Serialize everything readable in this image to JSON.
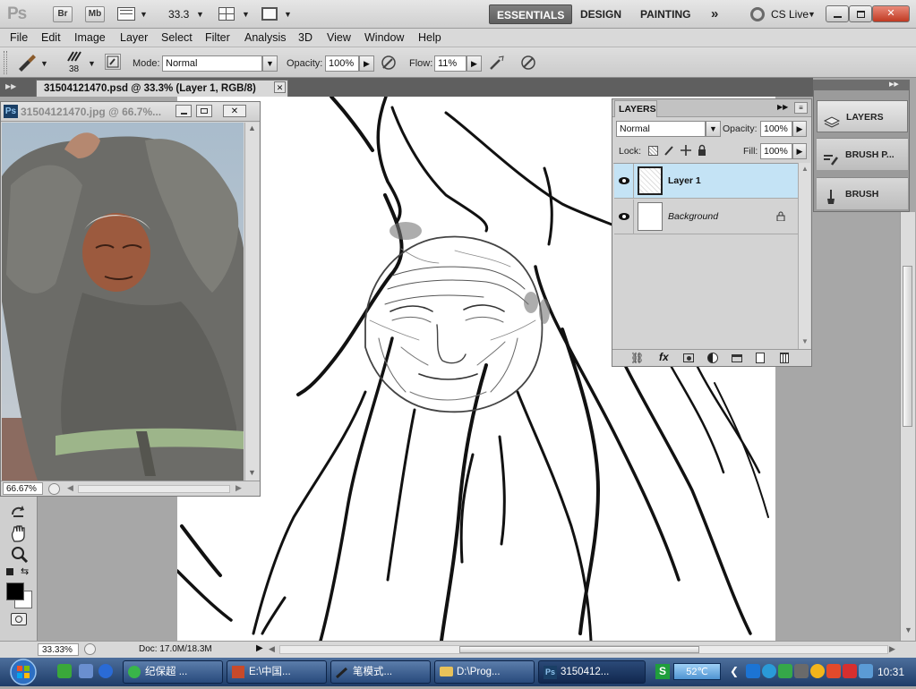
{
  "appbar": {
    "logo": "Ps",
    "bridge_label": "Br",
    "minibridge_label": "Mb",
    "zoom_value": "33.3",
    "workspaces": [
      "ESSENTIALS",
      "DESIGN",
      "PAINTING"
    ],
    "more_label": "»",
    "cslive_label": "CS Live"
  },
  "menubar": {
    "items": [
      "File",
      "Edit",
      "Image",
      "Layer",
      "Select",
      "Filter",
      "Analysis",
      "3D",
      "View",
      "Window",
      "Help"
    ]
  },
  "options": {
    "brush_size": "38",
    "mode_label": "Mode:",
    "mode_value": "Normal",
    "opacity_label": "Opacity:",
    "opacity_value": "100%",
    "flow_label": "Flow:",
    "flow_value": "11%"
  },
  "document": {
    "tab_title": "31504121470.psd @ 33.3% (Layer 1, RGB/8)",
    "status_zoom": "33.33%",
    "status_doc": "Doc: 17.0M/18.3M"
  },
  "photo_window": {
    "title": "31504121470.jpg @ 66.7%...",
    "ps_badge": "Ps",
    "zoom": "66.67%"
  },
  "layers_panel": {
    "title": "LAYERS",
    "blend_mode": "Normal",
    "opacity_label": "Opacity:",
    "opacity_value": "100%",
    "lock_label": "Lock:",
    "fill_label": "Fill:",
    "fill_value": "100%",
    "layers": [
      {
        "name": "Layer 1",
        "selected": true
      },
      {
        "name": "Background",
        "selected": false
      }
    ]
  },
  "dock": {
    "items": [
      "LAYERS",
      "BRUSH P...",
      "BRUSH"
    ]
  },
  "taskbar": {
    "items": [
      "纪保超 ...",
      "E:\\中国...",
      "笔模式...",
      "D:\\Prog...",
      "3150412..."
    ],
    "temperature": "52℃",
    "clock": "10:31"
  },
  "colors": {
    "workspace_active": "#6c6c6c",
    "layer_selected": "#c4e3f5",
    "taskbar": "#2a4a7a"
  }
}
